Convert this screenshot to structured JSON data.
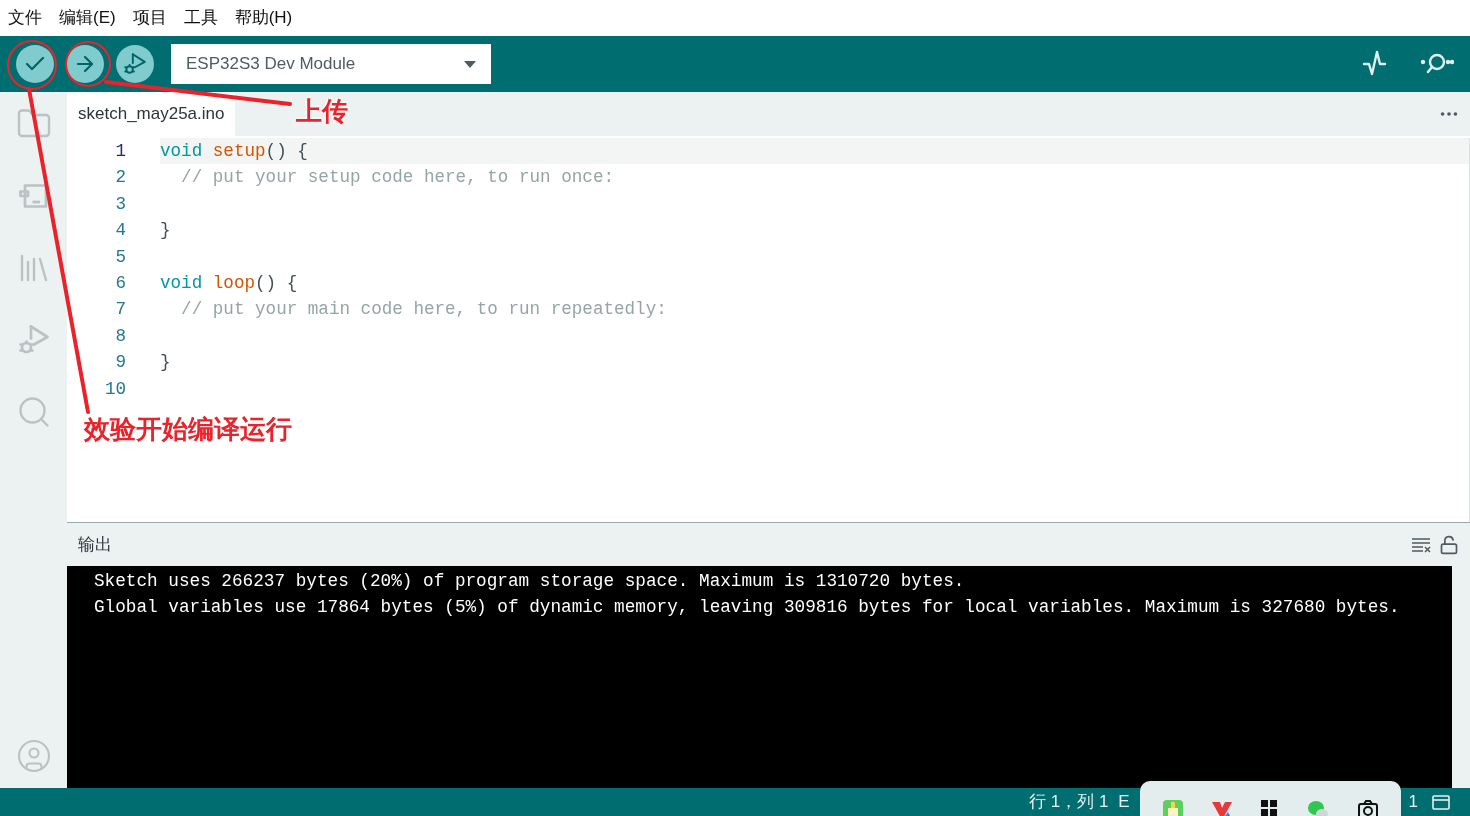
{
  "menu_bar": [
    "文件",
    "编辑(E)",
    "项目",
    "工具",
    "帮助(H)"
  ],
  "toolbar": {
    "buttons": [
      {
        "kind": "verify"
      },
      {
        "kind": "upload"
      },
      {
        "kind": "debug"
      }
    ],
    "board_select": {
      "value": "ESP32S3 Dev Module"
    }
  },
  "sidebar": {
    "items": [
      {
        "kind": "folder"
      },
      {
        "kind": "board"
      },
      {
        "kind": "library"
      },
      {
        "kind": "debug"
      },
      {
        "kind": "search"
      }
    ],
    "bottom": {
      "kind": "account"
    }
  },
  "editor": {
    "tabs": [
      {
        "label": "sketch_may25a.ino",
        "selected": true
      }
    ],
    "lines": [
      {
        "number": "1",
        "tokens": [
          {
            "kind": "keyword",
            "text": "void "
          },
          {
            "kind": "function",
            "text": "setup"
          },
          {
            "kind": "plain",
            "text": "() {"
          }
        ],
        "current": true
      },
      {
        "number": "2",
        "tokens": [
          {
            "kind": "comment",
            "text": "  // put your setup code here, to run once:"
          }
        ],
        "current": false
      },
      {
        "number": "3",
        "current": false
      },
      {
        "number": "4",
        "tokens": [
          {
            "kind": "plain",
            "text": "}"
          }
        ],
        "current": false
      },
      {
        "number": "5",
        "current": false
      },
      {
        "number": "6",
        "tokens": [
          {
            "kind": "keyword",
            "text": "void "
          },
          {
            "kind": "function",
            "text": "loop"
          },
          {
            "kind": "plain",
            "text": "() {"
          }
        ],
        "current": false
      },
      {
        "number": "7",
        "tokens": [
          {
            "kind": "comment",
            "text": "  // put your main code here, to run repeatedly:"
          }
        ],
        "current": false
      },
      {
        "number": "8",
        "current": false
      },
      {
        "number": "9",
        "tokens": [
          {
            "kind": "plain",
            "text": "}"
          }
        ],
        "current": false
      },
      {
        "number": "10",
        "current": false
      }
    ]
  },
  "output": {
    "title": "输出",
    "lines": [
      "Sketch uses 266237 bytes (20%) of program storage space. Maximum is 1310720 bytes.",
      "Global variables use 17864 bytes (5%) of dynamic memory, leaving 309816 bytes for local variables. Maximum is 327680 bytes."
    ]
  },
  "status_bar": {
    "position": "行 1，列 1",
    "item_2": "E",
    "item_3": "1"
  },
  "annotations": [
    {
      "kind": "label",
      "text": "效验开始编译运行"
    },
    {
      "kind": "label",
      "text": "上传"
    }
  ]
}
